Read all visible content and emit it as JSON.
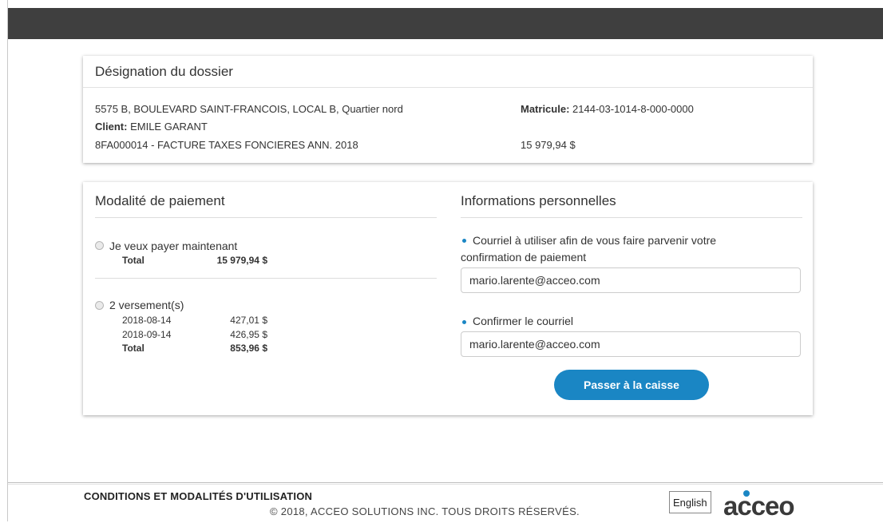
{
  "dossier": {
    "title": "Désignation du dossier",
    "address": "5575 B, BOULEVARD SAINT-FRANCOIS, LOCAL B, Quartier nord",
    "matricule_label": "Matricule:",
    "matricule_value": "2144-03-1014-8-000-0000",
    "client_label": "Client:",
    "client_value": "EMILE GARANT",
    "invoice": "8FA000014 - FACTURE TAXES FONCIERES ANN. 2018",
    "amount": "15 979,94 $"
  },
  "payment": {
    "title": "Modalité de paiement",
    "option_full": {
      "label": "Je veux payer maintenant",
      "total_label": "Total",
      "total_value": "15 979,94 $",
      "selected": false
    },
    "option_installments": {
      "label": "2 versement(s)",
      "rows": [
        {
          "date": "2018-08-14",
          "amount": "427,01 $"
        },
        {
          "date": "2018-09-14",
          "amount": "426,95 $"
        }
      ],
      "total_label": "Total",
      "total_value": "853,96 $",
      "selected": false
    }
  },
  "personal": {
    "title": "Informations personnelles",
    "email_label_line1": "Courriel à utiliser afin de vous faire parvenir votre",
    "email_label_line2": "confirmation de paiement",
    "email_value": "mario.larente@acceo.com",
    "confirm_label": "Confirmer le courriel",
    "confirm_value": "mario.larente@acceo.com",
    "checkout_label": "Passer à la caisse"
  },
  "footer": {
    "terms_link": "CONDITIONS ET MODALITÉS D'UTILISATION",
    "copyright": "© 2018, ACCEO SOLUTIONS INC. TOUS DROITS RÉSERVÉS.",
    "language_button": "English",
    "logo_text": "acceo"
  },
  "colors": {
    "top_bar": "#3f3f3f",
    "accent": "#1a86c4"
  }
}
